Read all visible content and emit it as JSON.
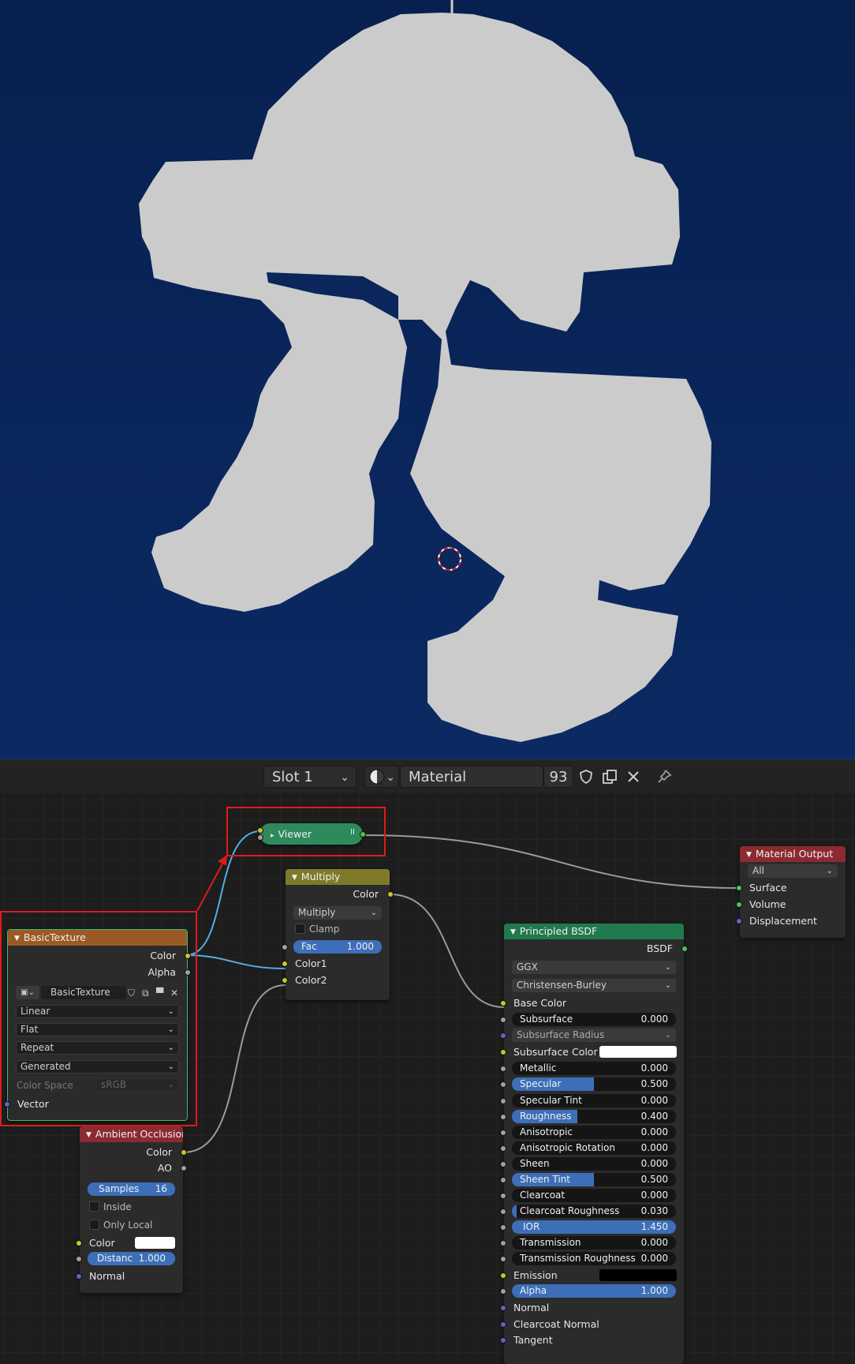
{
  "header": {
    "slot": "Slot 1",
    "material": "Material",
    "users": "93"
  },
  "nodes": {
    "viewer": {
      "title": "Viewer"
    },
    "multiply": {
      "title": "Multiply",
      "out_color": "Color",
      "mode": "Multiply",
      "clamp": "Clamp",
      "fac_label": "Fac",
      "fac_value": "1.000",
      "color1": "Color1",
      "color2": "Color2"
    },
    "basic_texture": {
      "title": "BasicTexture",
      "out_color": "Color",
      "out_alpha": "Alpha",
      "image_name": "BasicTexture",
      "interpolation": "Linear",
      "projection": "Flat",
      "extension": "Repeat",
      "source": "Generated",
      "color_space_label": "Color Space",
      "color_space": "sRGB",
      "vector": "Vector"
    },
    "ambient_occlusion": {
      "title": "Ambient Occlusion",
      "out_color": "Color",
      "out_ao": "AO",
      "samples_label": "Samples",
      "samples_value": "16",
      "inside": "Inside",
      "only_local": "Only Local",
      "color": "Color",
      "distance_label": "Distanc",
      "distance_value": "1.000",
      "normal": "Normal"
    },
    "material_output": {
      "title": "Material Output",
      "target": "All",
      "surface": "Surface",
      "volume": "Volume",
      "displacement": "Displacement"
    },
    "principled": {
      "title": "Principled BSDF",
      "out_bsdf": "BSDF",
      "distribution": "GGX",
      "subsurface_method": "Christensen-Burley",
      "base_color": "Base Color",
      "subsurface_radius": "Subsurface Radius",
      "subsurface_color": "Subsurface Color",
      "emission": "Emission",
      "normal": "Normal",
      "clearcoat_normal": "Clearcoat Normal",
      "tangent": "Tangent",
      "sliders": [
        {
          "label": "Subsurface",
          "value": "0.000",
          "fraction": 0
        },
        {
          "label": "Metallic",
          "value": "0.000",
          "fraction": 0
        },
        {
          "label": "Specular",
          "value": "0.500",
          "fraction": 0.5
        },
        {
          "label": "Specular Tint",
          "value": "0.000",
          "fraction": 0
        },
        {
          "label": "Roughness",
          "value": "0.400",
          "fraction": 0.4
        },
        {
          "label": "Anisotropic",
          "value": "0.000",
          "fraction": 0
        },
        {
          "label": "Anisotropic Rotation",
          "value": "0.000",
          "fraction": 0
        },
        {
          "label": "Sheen",
          "value": "0.000",
          "fraction": 0
        },
        {
          "label": "Sheen Tint",
          "value": "0.500",
          "fraction": 0.5
        },
        {
          "label": "Clearcoat",
          "value": "0.000",
          "fraction": 0
        },
        {
          "label": "Clearcoat Roughness",
          "value": "0.030",
          "fraction": 0.03
        },
        {
          "label": "IOR",
          "value": "1.450",
          "fraction": 1
        },
        {
          "label": "Transmission",
          "value": "0.000",
          "fraction": 0
        },
        {
          "label": "Transmission Roughness",
          "value": "0.000",
          "fraction": 0
        },
        {
          "label": "Alpha",
          "value": "1.000",
          "fraction": 1
        }
      ]
    }
  },
  "colors": {
    "viewport_bg": "#0a265b",
    "model": "#cbcbcb",
    "header_texture": "#9b5a25",
    "header_color": "#7f7a2a",
    "header_shader": "#217a4e",
    "header_output": "#8c2a31",
    "highlight": "#e01b1b"
  }
}
